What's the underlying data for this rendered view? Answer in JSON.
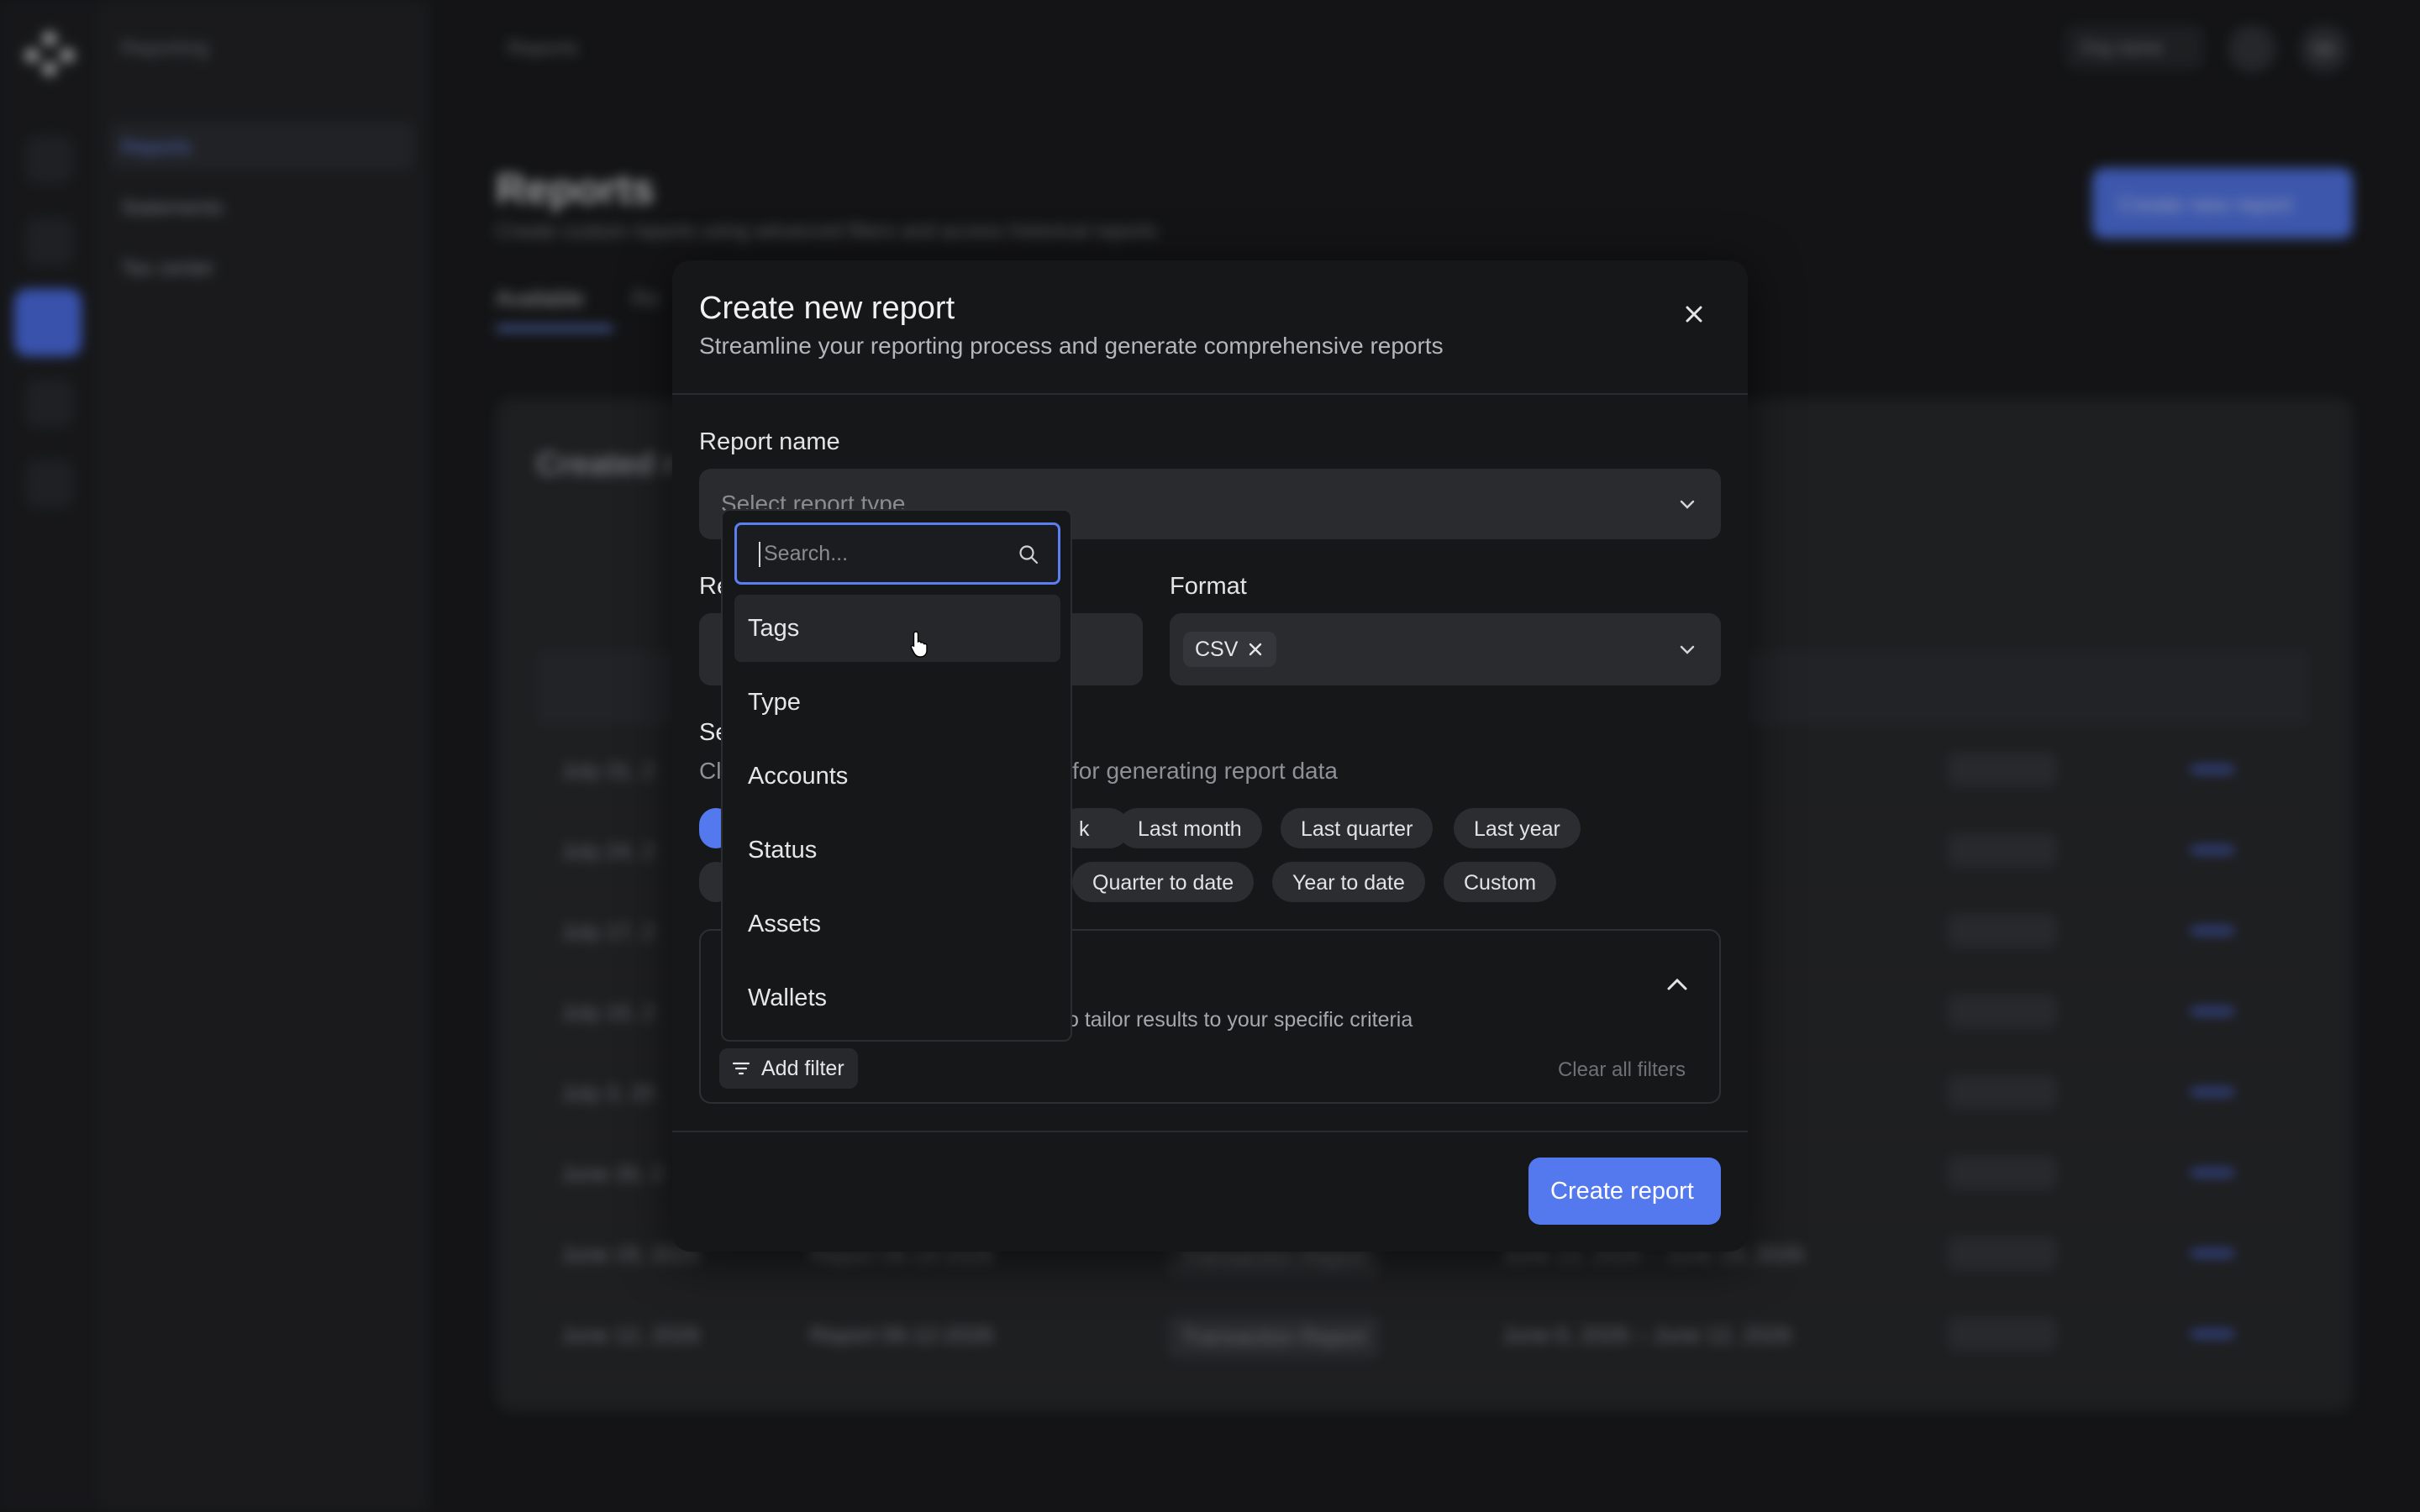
{
  "background": {
    "nav": {
      "breadcrumb": "Reporting",
      "items": [
        "Reports",
        "Statements",
        "Tax center"
      ]
    },
    "topbar": {
      "breadcrumb": "Reports",
      "org_pill": "Org name",
      "avatar_initials": "SK"
    },
    "page": {
      "title": "Reports",
      "subtitle": "Create custom reports using advanced filters and access historical reports",
      "create_button": "Create new report",
      "tabs": [
        "Available",
        "Re"
      ],
      "card_title": "Created r"
    },
    "table_rows": [
      {
        "created": "July 31, 2",
        "date_range": "1, 2026"
      },
      {
        "created": "July 24, 2",
        "date_range": "4, 2026"
      },
      {
        "created": "July 17, 2",
        "date_range": "7, 2026"
      },
      {
        "created": "July 10, 2",
        "date_range": "0, 2026"
      },
      {
        "created": "July 3, 20",
        "date_range": "3, 2026"
      },
      {
        "created": "June 26, 2",
        "date_range": "26, 2026"
      },
      {
        "created": "June 19, 2026",
        "name": "Report 06-19-2026",
        "type": "Transaction Report",
        "date_range": "June 13, 2026 – June 19, 2026"
      },
      {
        "created": "June 12, 2026",
        "name": "Report 06-12-2026",
        "type": "Transaction Report",
        "date_range": "June 6, 2026 – June 12, 2026"
      }
    ]
  },
  "modal": {
    "title": "Create new report",
    "subtitle": "Streamline your reporting process and generate comprehensive reports",
    "report_name_label": "Report name",
    "report_type_placeholder": "Select report type",
    "format_label": "Format",
    "format_chip": "CSV",
    "range_label_partial": "Re",
    "section_label_partial": "Se",
    "date_hint_partial": "Cl",
    "date_hint": "for generating report data",
    "date_chips_row1": [
      "k",
      "Last month",
      "Last quarter",
      "Last year"
    ],
    "date_chips_row2": [
      "Quarter to date",
      "Year to date",
      "Custom"
    ],
    "filters_hint": "o tailor results to your specific criteria",
    "add_filter_label": "Add filter",
    "clear_all_label": "Clear all filters",
    "create_button": "Create report"
  },
  "dropdown": {
    "search_placeholder": "Search...",
    "options": [
      "Tags",
      "Type",
      "Accounts",
      "Status",
      "Assets",
      "Wallets"
    ],
    "hovered": "Tags"
  },
  "colors": {
    "accent": "#5479ef",
    "modal_bg": "#161719",
    "field_bg": "#2a2b2f"
  }
}
